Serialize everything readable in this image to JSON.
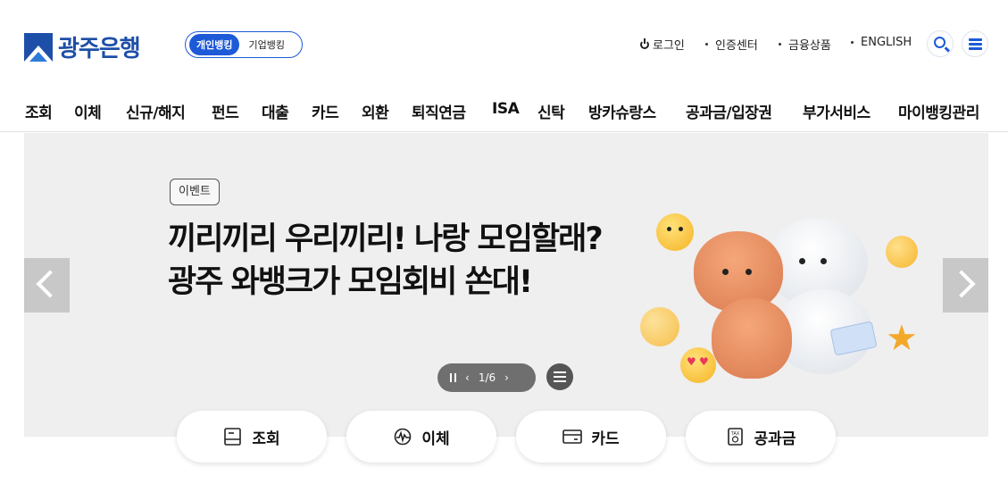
{
  "header": {
    "logo_text": "광주은행",
    "toggle": {
      "personal": "개인뱅킹",
      "corporate": "기업뱅킹"
    },
    "utility": {
      "login": "로그인",
      "cert_center": "인증센터",
      "products": "금융상품",
      "english": "ENGLISH"
    },
    "icons": [
      "search-icon",
      "menu-icon",
      "power-icon"
    ],
    "brand_color": "#1d5ad8"
  },
  "gnb": [
    "조회",
    "이체",
    "신규/해지",
    "펀드",
    "대출",
    "카드",
    "외환",
    "퇴직연금",
    "ISA",
    "신탁",
    "방카슈랑스",
    "공과금/입장권",
    "부가서비스",
    "마이뱅킹관리"
  ],
  "banner": {
    "tag": "이벤트",
    "headline_line1": "끼리끼리 우리끼리! 나랑 모임할래?",
    "headline_line2": "광주 와뱅크가 모임회비 쏜대!",
    "pager": "1/6",
    "background": "#efefef"
  },
  "quick_menu": [
    {
      "label": "조회",
      "icon": "inquiry-icon"
    },
    {
      "label": "이체",
      "icon": "transfer-icon"
    },
    {
      "label": "카드",
      "icon": "card-icon"
    },
    {
      "label": "공과금",
      "icon": "tax-icon"
    }
  ]
}
